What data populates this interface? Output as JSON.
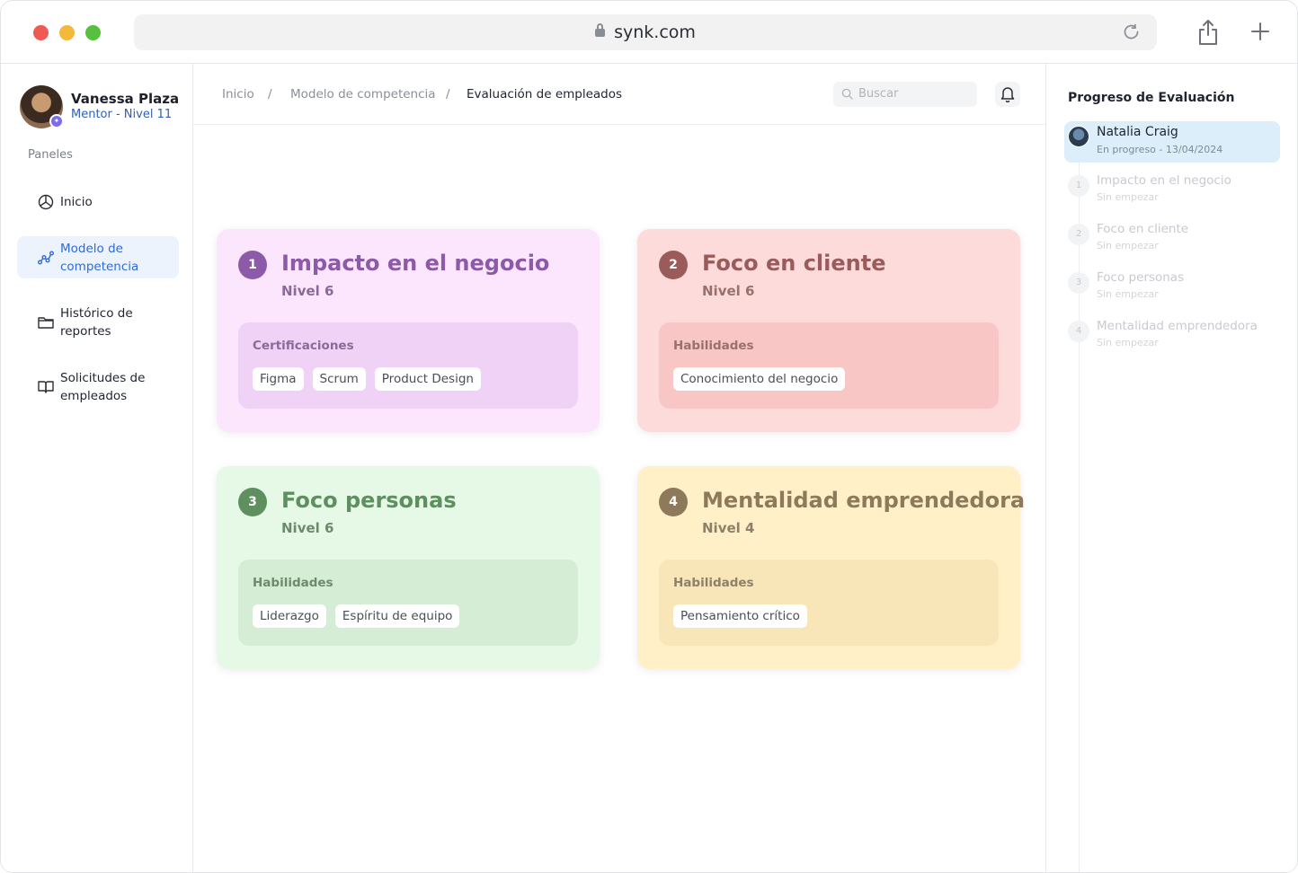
{
  "browser": {
    "url": "synk.com"
  },
  "user": {
    "name": "Vanessa Plaza",
    "role": "Mentor - Nivel 11"
  },
  "sidebar": {
    "section_label": "Paneles",
    "items": [
      {
        "label_line1": "Inicio",
        "label_line2": "",
        "icon": "pie-chart-icon",
        "active": false
      },
      {
        "label_line1": "Modelo de",
        "label_line2": "competencia",
        "icon": "graph-icon",
        "active": true
      },
      {
        "label_line1": "Histórico de",
        "label_line2": "reportes",
        "icon": "folder-icon",
        "active": false
      },
      {
        "label_line1": "Solicitudes de",
        "label_line2": "empleados",
        "icon": "book-icon",
        "active": false
      }
    ]
  },
  "breadcrumb": {
    "items": [
      "Inicio",
      "Modelo de competencia",
      "Evaluación de empleados"
    ],
    "separator": "/"
  },
  "search": {
    "placeholder": "Buscar"
  },
  "cards": [
    {
      "number": "1",
      "title": "Impacto en el negocio",
      "level": "Nivel 6",
      "section": "Certificaciones",
      "tags": [
        "Figma",
        "Scrum",
        "Product Design"
      ],
      "color": "#8c5aa8"
    },
    {
      "number": "2",
      "title": "Foco en cliente",
      "level": "Nivel 6",
      "section": "Habilidades",
      "tags": [
        "Conocimiento del negocio"
      ],
      "color": "#9a5c5a"
    },
    {
      "number": "3",
      "title": "Foco personas",
      "level": "Nivel 6",
      "section": "Habilidades",
      "tags": [
        "Liderazgo",
        "Espíritu de equipo"
      ],
      "color": "#5e8f5f"
    },
    {
      "number": "4",
      "title": "Mentalidad emprendedora",
      "level": "Nivel 4",
      "section": "Habilidades",
      "tags": [
        "Pensamiento crítico"
      ],
      "color": "#8e7a5a"
    }
  ],
  "progress": {
    "title": "Progreso de Evaluación",
    "employee": {
      "name": "Natalia Craig",
      "status": "En progreso - 13/04/2024"
    },
    "steps": [
      {
        "number": "1",
        "title": "Impacto en el negocio",
        "status": "Sin empezar"
      },
      {
        "number": "2",
        "title": "Foco en cliente",
        "status": "Sin empezar"
      },
      {
        "number": "3",
        "title": "Foco personas",
        "status": "Sin empezar"
      },
      {
        "number": "4",
        "title": "Mentalidad emprendedora",
        "status": "Sin empezar"
      }
    ]
  }
}
